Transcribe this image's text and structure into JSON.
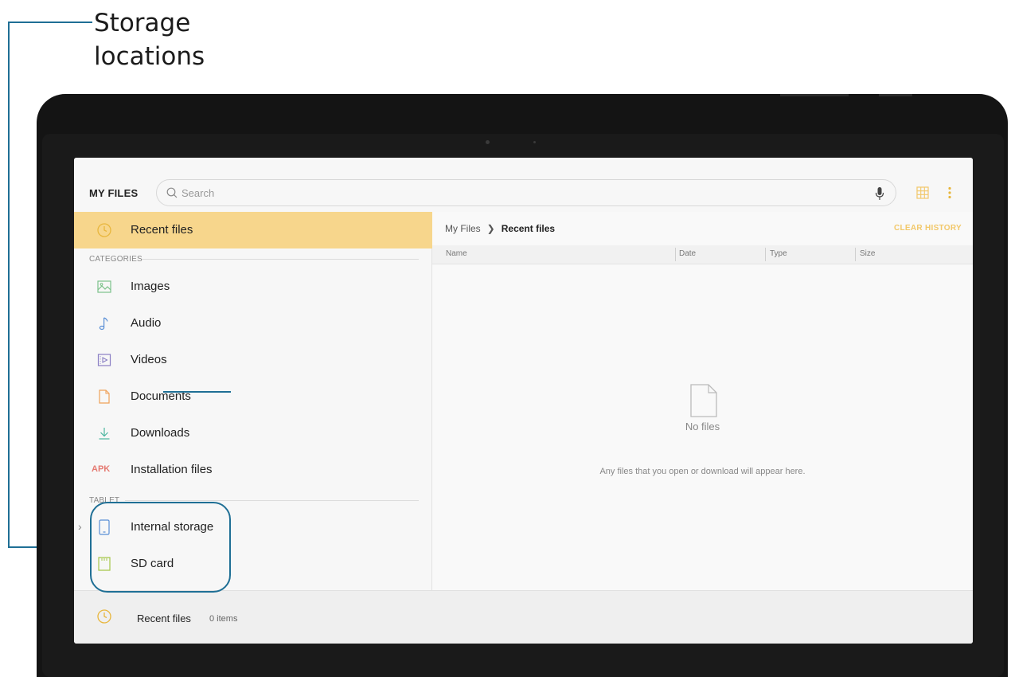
{
  "callout": {
    "line1": "Storage",
    "line2": "locations",
    "color": "#1f6f95"
  },
  "app": {
    "title": "MY FILES",
    "accent": "#f7d68c"
  },
  "search": {
    "placeholder": "Search",
    "icon": "search-icon",
    "voice_icon": "microphone-icon"
  },
  "toolbar": {
    "view_icon": "grid-view-icon",
    "more_icon": "more-options-icon"
  },
  "sidebar": {
    "recent": {
      "label": "Recent files",
      "icon": "clock-icon"
    },
    "categories_header": "CATEGORIES",
    "categories": [
      {
        "label": "Images",
        "icon": "image-icon"
      },
      {
        "label": "Audio",
        "icon": "music-note-icon"
      },
      {
        "label": "Videos",
        "icon": "video-icon"
      },
      {
        "label": "Documents",
        "icon": "document-icon"
      },
      {
        "label": "Downloads",
        "icon": "download-icon"
      },
      {
        "label": "Installation files",
        "icon": "APK"
      }
    ],
    "tablet_header": "TABLET",
    "storage": [
      {
        "label": "Internal storage",
        "icon": "phone-storage-icon"
      },
      {
        "label": "SD card",
        "icon": "sd-card-icon"
      }
    ]
  },
  "main": {
    "breadcrumb_root": "My Files",
    "breadcrumb_current": "Recent files",
    "clear_history": "CLEAR HISTORY",
    "columns": [
      "Name",
      "Date",
      "Type",
      "Size"
    ],
    "empty_title": "No files",
    "empty_message": "Any files that you open or download will appear here."
  },
  "bottom": {
    "label": "Recent files",
    "count": "0 items"
  }
}
